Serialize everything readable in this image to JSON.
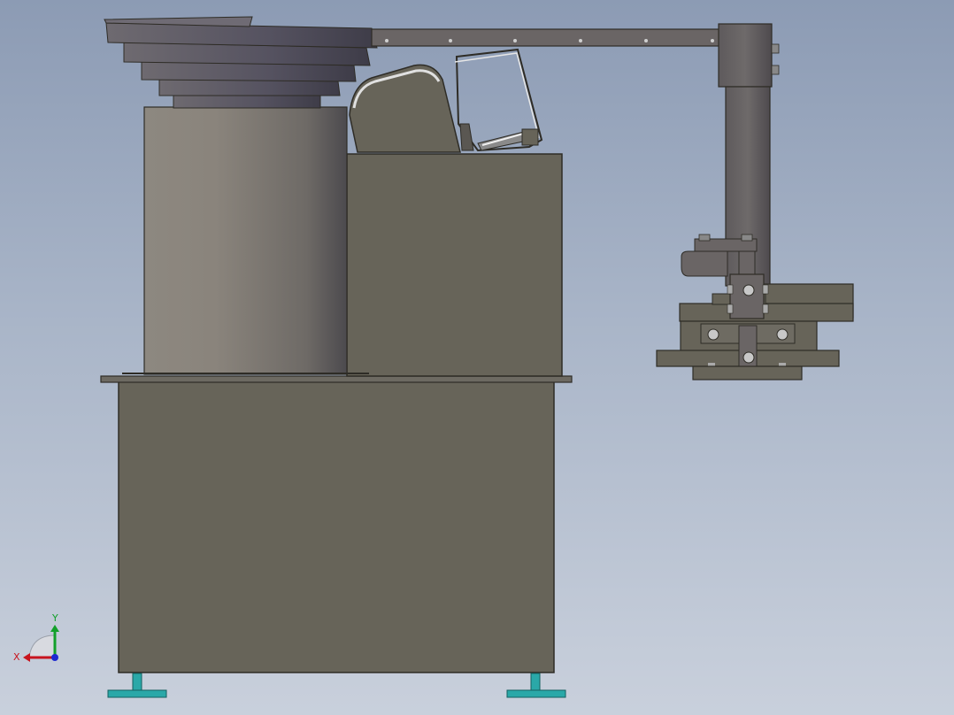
{
  "axes_triad": {
    "x_label": "X",
    "y_label": "Y",
    "x_color": "#c8141e",
    "y_color": "#12a02a",
    "z_color": "#1e2ad0"
  },
  "colors": {
    "cabinet": "#676459",
    "cabinet_edge": "#2e2c26",
    "bowl_dark": "#4a4852",
    "bowl_light": "#6e6a70",
    "arm": "#6a6565",
    "feet": "#2aa8a8",
    "bolt": "#c8c8c8"
  }
}
